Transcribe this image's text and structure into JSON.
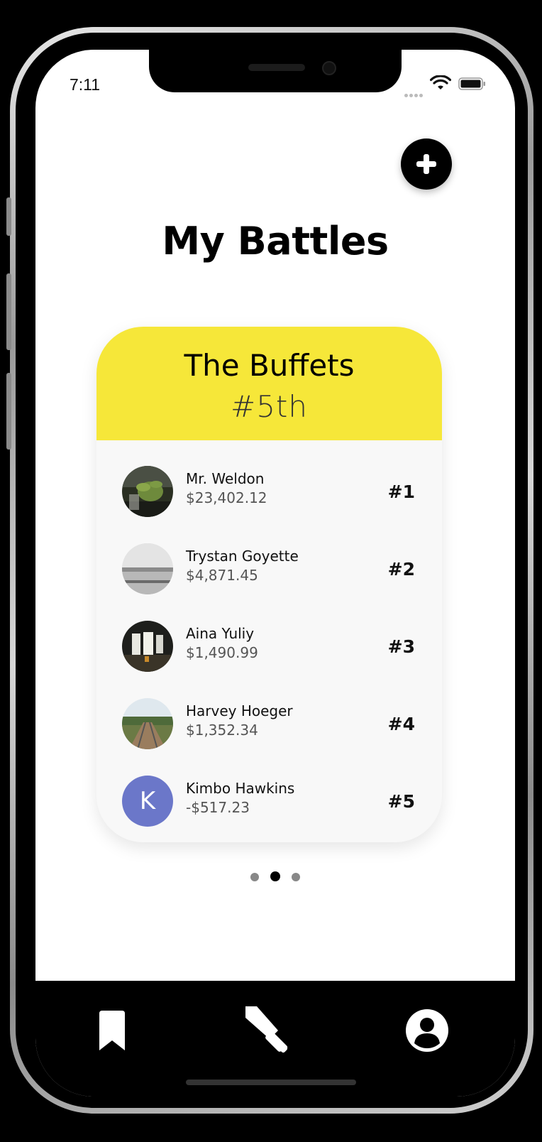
{
  "status_bar": {
    "time": "7:11"
  },
  "header": {
    "title": "My Battles",
    "add_button": "plus-icon"
  },
  "battle_card": {
    "group_name": "The Buffets",
    "group_rank": "#5th",
    "header_color": "#f6e739",
    "members": [
      {
        "name": "Mr. Weldon",
        "amount": "$23,402.12",
        "rank": "#1",
        "avatar": "plant-photo"
      },
      {
        "name": "Trystan Goyette",
        "amount": "$4,871.45",
        "rank": "#2",
        "avatar": "seascape-photo"
      },
      {
        "name": "Aina Yuliy",
        "amount": "$1,490.99",
        "rank": "#3",
        "avatar": "waterfall-photo"
      },
      {
        "name": "Harvey Hoeger",
        "amount": "$1,352.34",
        "rank": "#4",
        "avatar": "railway-photo"
      },
      {
        "name": "Kimbo Hawkins",
        "amount": "-$517.23",
        "rank": "#5",
        "avatar_initial": "K",
        "avatar_color": "#6b77c9"
      }
    ]
  },
  "pager": {
    "count": 3,
    "active_index": 1
  },
  "tab_bar": {
    "items": [
      {
        "icon": "bookmark-icon"
      },
      {
        "icon": "sword-icon",
        "active": true
      },
      {
        "icon": "profile-icon"
      }
    ]
  }
}
